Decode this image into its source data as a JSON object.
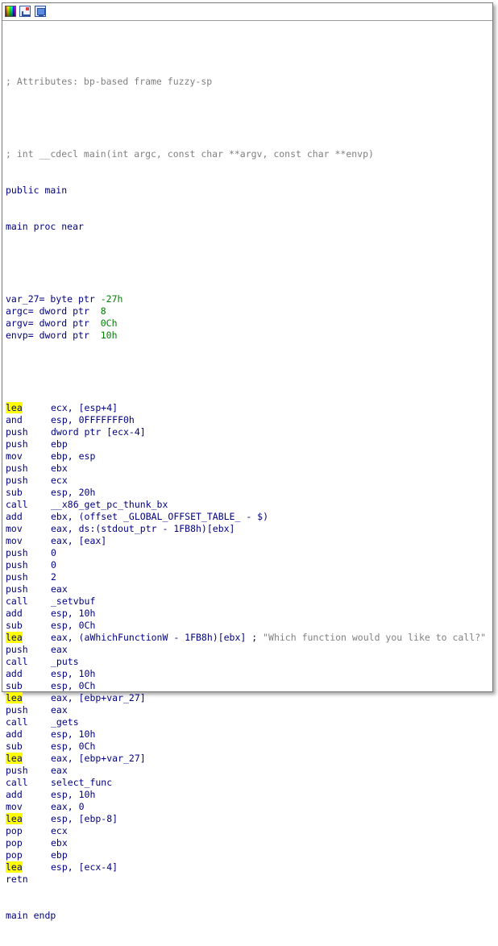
{
  "toolbar": {
    "icons": [
      "color-palette-icon",
      "graph-view-icon",
      "screen-view-icon"
    ]
  },
  "header": {
    "attributes_comment": "; Attributes: bp-based frame fuzzy-sp",
    "signature_comment": "; int __cdecl main(int argc, const char **argv, const char **envp)",
    "public_line": "public main",
    "proc_line": "main proc near"
  },
  "vars": [
    {
      "name": "var_27",
      "sep": "= ",
      "type": "byte ptr ",
      "value": "-27h"
    },
    {
      "name": "argc",
      "sep": "= ",
      "type": "dword ptr  ",
      "value": "8"
    },
    {
      "name": "argv",
      "sep": "= ",
      "type": "dword ptr  ",
      "value": "0Ch"
    },
    {
      "name": "envp",
      "sep": "= ",
      "type": "dword ptr  ",
      "value": "10h"
    }
  ],
  "instructions": [
    {
      "m": "lea",
      "op": "ecx, [esp+4]",
      "hl": true
    },
    {
      "m": "and",
      "op": "esp, 0FFFFFFF0h"
    },
    {
      "m": "push",
      "op": "dword ptr [ecx-4]"
    },
    {
      "m": "push",
      "op": "ebp"
    },
    {
      "m": "mov",
      "op": "ebp, esp"
    },
    {
      "m": "push",
      "op": "ebx"
    },
    {
      "m": "push",
      "op": "ecx"
    },
    {
      "m": "sub",
      "op": "esp, 20h"
    },
    {
      "m": "call",
      "op": "__x86_get_pc_thunk_bx"
    },
    {
      "m": "add",
      "op": "ebx, (offset _GLOBAL_OFFSET_TABLE_ - $)"
    },
    {
      "m": "mov",
      "op": "eax, ds:(stdout_ptr - 1FB8h)[ebx]"
    },
    {
      "m": "mov",
      "op": "eax, [eax]"
    },
    {
      "m": "push",
      "op": "0"
    },
    {
      "m": "push",
      "op": "0"
    },
    {
      "m": "push",
      "op": "2"
    },
    {
      "m": "push",
      "op": "eax"
    },
    {
      "m": "call",
      "op": "_setvbuf"
    },
    {
      "m": "add",
      "op": "esp, 10h"
    },
    {
      "m": "sub",
      "op": "esp, 0Ch"
    },
    {
      "m": "lea",
      "op": "eax, (aWhichFunctionW - 1FB8h)[ebx] ; ",
      "comment": "\"Which function would you like to call?\"",
      "hl": true
    },
    {
      "m": "push",
      "op": "eax"
    },
    {
      "m": "call",
      "op": "_puts"
    },
    {
      "m": "add",
      "op": "esp, 10h"
    },
    {
      "m": "sub",
      "op": "esp, 0Ch"
    },
    {
      "m": "lea",
      "op": "eax, [ebp+var_27]",
      "hl": true
    },
    {
      "m": "push",
      "op": "eax"
    },
    {
      "m": "call",
      "op": "_gets"
    },
    {
      "m": "add",
      "op": "esp, 10h"
    },
    {
      "m": "sub",
      "op": "esp, 0Ch"
    },
    {
      "m": "lea",
      "op": "eax, [ebp+var_27]",
      "hl": true
    },
    {
      "m": "push",
      "op": "eax"
    },
    {
      "m": "call",
      "op": "select_func"
    },
    {
      "m": "add",
      "op": "esp, 10h"
    },
    {
      "m": "mov",
      "op": "eax, 0"
    },
    {
      "m": "lea",
      "op": "esp, [ebp-8]",
      "hl": true
    },
    {
      "m": "pop",
      "op": "ecx"
    },
    {
      "m": "pop",
      "op": "ebx"
    },
    {
      "m": "pop",
      "op": "ebp"
    },
    {
      "m": "lea",
      "op": "esp, [ecx-4]",
      "hl": true
    },
    {
      "m": "retn",
      "op": ""
    }
  ],
  "footer": {
    "endp_line": "main endp"
  },
  "colors": {
    "code": "#000080",
    "comment": "#808080",
    "highlight": "#ffff00",
    "value": "#008000"
  }
}
